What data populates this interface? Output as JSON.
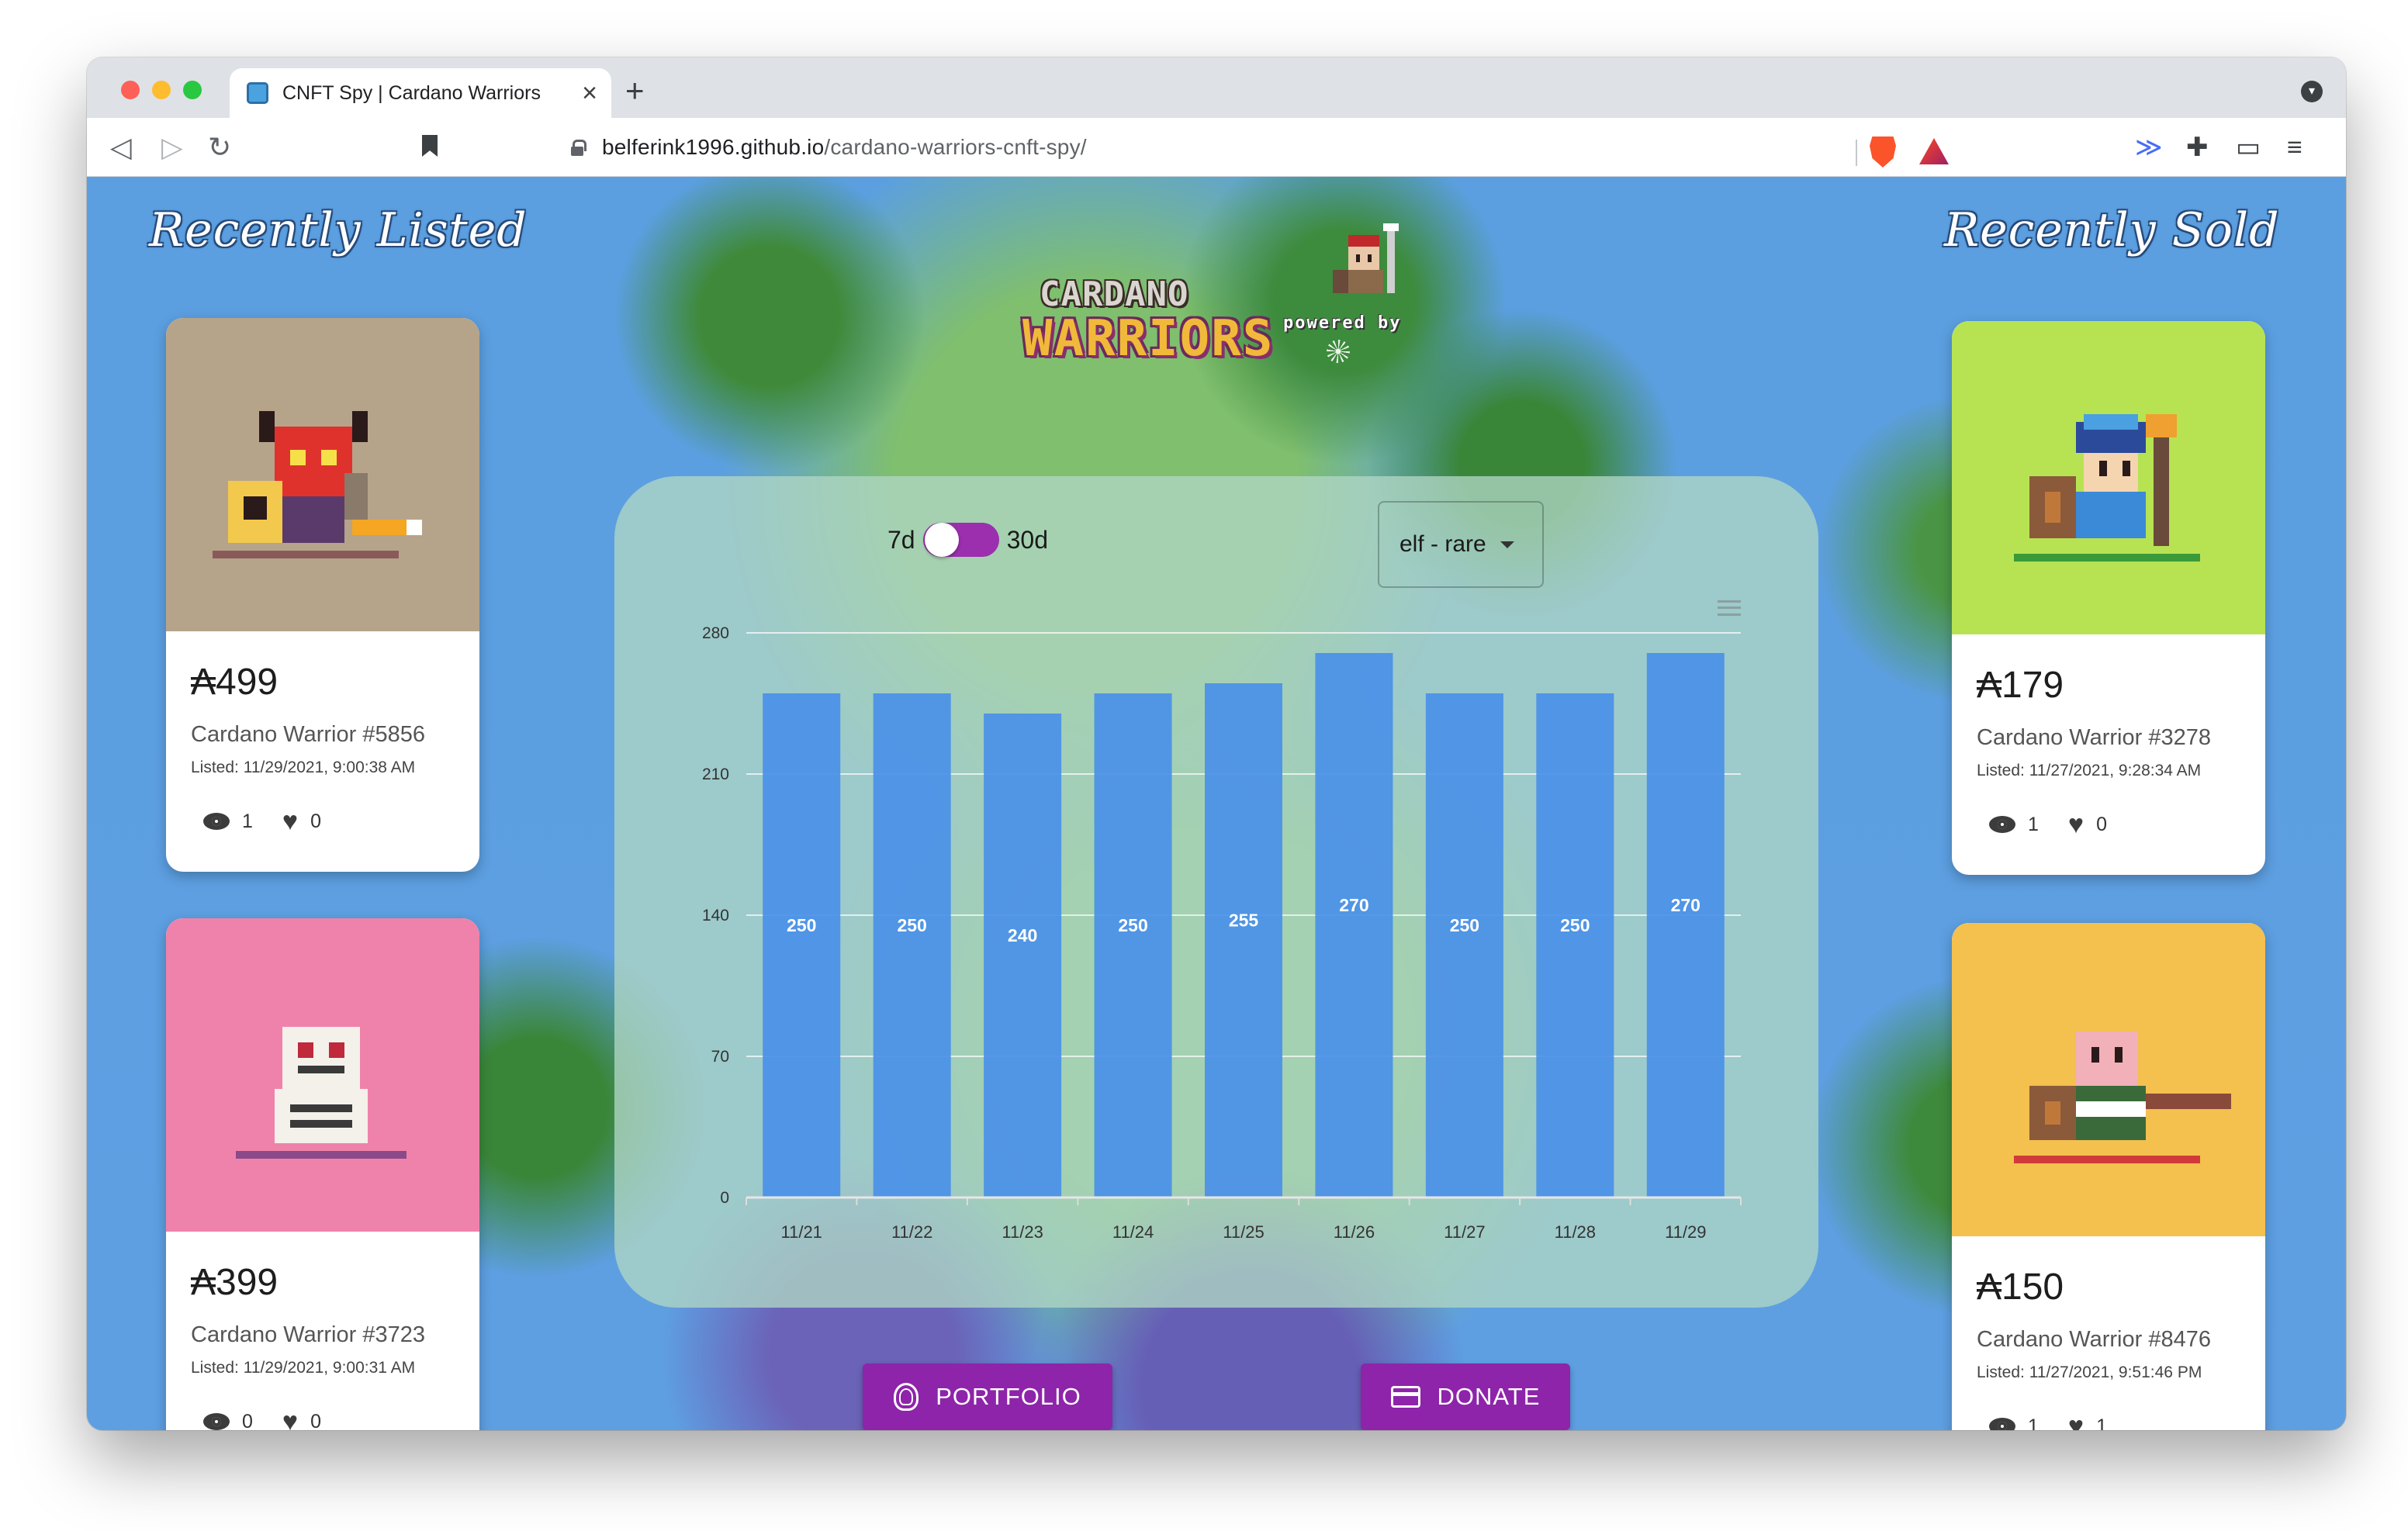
{
  "browser": {
    "tab_title": "CNFT Spy | Cardano Warriors",
    "url_host": "belferink1996.github.io",
    "url_path": "/cardano-warriors-cnft-spy/"
  },
  "page": {
    "recently_listed_title": "Recently Listed",
    "recently_sold_title": "Recently Sold",
    "logo": {
      "line1": "CARDANO",
      "line2": "WARRIORS",
      "powered_by": "powered by"
    },
    "toggle": {
      "left_label": "7d",
      "right_label": "30d",
      "selected": "7d"
    },
    "select": {
      "value": "elf - rare"
    },
    "buttons": {
      "portfolio": "PORTFOLIO",
      "donate": "DONATE"
    }
  },
  "listed": [
    {
      "price": "₳499",
      "name": "Cardano Warrior #5856",
      "time": "Listed: 11/29/2021, 9:00:38 AM",
      "views": "1",
      "likes": "0",
      "bg": "#b5a48a"
    },
    {
      "price": "₳399",
      "name": "Cardano Warrior #3723",
      "time": "Listed: 11/29/2021, 9:00:31 AM",
      "views": "0",
      "likes": "0",
      "bg": "#ef82aa"
    }
  ],
  "sold": [
    {
      "price": "₳179",
      "name": "Cardano Warrior #3278",
      "time": "Listed: 11/27/2021, 9:28:34 AM",
      "views": "1",
      "likes": "0",
      "bg": "#b7e353"
    },
    {
      "price": "₳150",
      "name": "Cardano Warrior #8476",
      "time": "Listed: 11/27/2021, 9:51:46 PM",
      "views": "1",
      "likes": "1",
      "bg": "#f4c04e"
    }
  ],
  "chart_data": {
    "type": "bar",
    "categories": [
      "11/21",
      "11/22",
      "11/23",
      "11/24",
      "11/25",
      "11/26",
      "11/27",
      "11/28",
      "11/29"
    ],
    "values": [
      250,
      250,
      240,
      250,
      255,
      270,
      250,
      250,
      270
    ],
    "yticks": [
      0,
      70,
      140,
      210,
      280
    ],
    "ylim": [
      0,
      280
    ],
    "grid": true,
    "data_labels": true,
    "bar_color": "#4a90e8"
  },
  "colors": {
    "accent": "#8e24aa",
    "bar": "#4a90e8",
    "background": "#5e9fe2"
  }
}
